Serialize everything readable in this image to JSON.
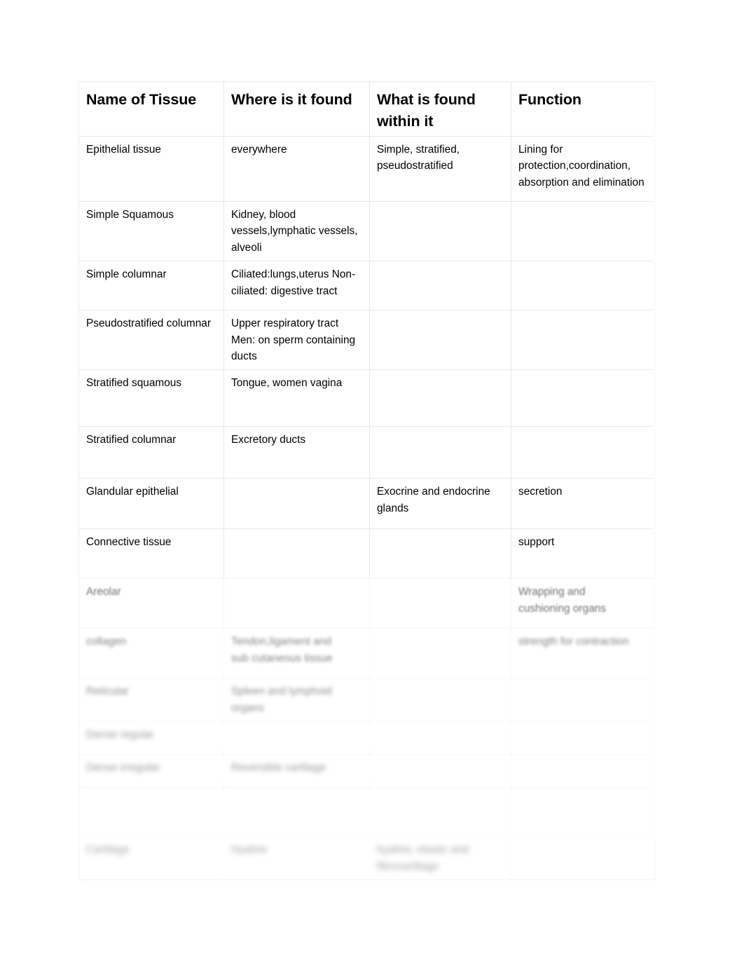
{
  "document": {
    "title": "Name of Tissue",
    "type": "study-table",
    "columns": [
      "Name of Tissue",
      "Where is it found",
      "What is found within it",
      "Function"
    ],
    "note_legibility": "Lower portion of the scanned page is progressively out of focus; text in those rows is not legible."
  },
  "rows": [
    {
      "name": "Epithelial tissue",
      "where": "everywhere",
      "within": "Simple, stratified, pseudostratified",
      "function": "Lining for protection,coordination, absorption and elimination",
      "legible": true,
      "blur": 0
    },
    {
      "name": "Simple Squamous",
      "where": "Kidney, blood vessels,lymphatic vessels, alveoli",
      "within": "",
      "function": "",
      "legible": true,
      "blur": 0
    },
    {
      "name": "Simple columnar",
      "where": "Ciliated:lungs,uterus Non-ciliated: digestive tract",
      "within": "",
      "function": "",
      "legible": true,
      "blur": 0
    },
    {
      "name": "Pseudostratified columnar",
      "where": "Upper respiratory tract Men: on sperm containing ducts",
      "within": "",
      "function": "",
      "legible": true,
      "blur": 0
    },
    {
      "name": "Stratified squamous",
      "where": "Tongue, women vagina",
      "within": "",
      "function": "",
      "legible": true,
      "blur": 0
    },
    {
      "name": "Stratified columnar",
      "where": "Excretory ducts",
      "within": "",
      "function": "",
      "legible": true,
      "blur": 0
    },
    {
      "name": "Glandular epithelial",
      "where": "",
      "within": "Exocrine and endocrine glands",
      "function": "secretion",
      "legible": true,
      "blur": 0
    },
    {
      "name": "Connective tissue",
      "where": "",
      "within": "",
      "function": "support",
      "legible": true,
      "blur": 1
    },
    {
      "name": "Areolar",
      "where": "",
      "within": "",
      "function": "",
      "legible": false,
      "blur": 2
    },
    {
      "name": "",
      "where": "",
      "within": "",
      "function": "",
      "legible": false,
      "blur": 3
    },
    {
      "name": "",
      "where": "",
      "within": "",
      "function": "",
      "legible": false,
      "blur": 4
    },
    {
      "name": "",
      "where": "",
      "within": "",
      "function": "",
      "legible": false,
      "blur": 5
    },
    {
      "name": "",
      "where": "",
      "within": "",
      "function": "",
      "legible": false,
      "blur": 5
    },
    {
      "name": "",
      "where": "",
      "within": "",
      "function": "",
      "legible": false,
      "blur": 6
    },
    {
      "name": "",
      "where": "",
      "within": "",
      "function": "",
      "legible": false,
      "blur": 6
    }
  ],
  "illegible_rows": {
    "r9": {
      "function_line1": "Wrapping and",
      "function_line2": "cushioning organs"
    },
    "r10": {
      "name": "collagen",
      "where_line1": "Tendon,ligament and",
      "where_line2": "sub cutaneous tissue",
      "function": "strength for contraction"
    },
    "r11": {
      "name": "Reticular",
      "where_line1": "Spleen and lymphoid",
      "where_line2": "organs"
    },
    "r12": {
      "name": "Dense regular"
    },
    "r13": {
      "name": "Dense irregular",
      "where": "Reversible cartilage"
    },
    "r15": {
      "name": "Cartilage",
      "where": "Hyaline",
      "within_line1": "hyaline, elastic and",
      "within_line2": "fibrocartilage"
    }
  },
  "colors": {
    "page_background": "#ffffff",
    "table_background": "#ffffff",
    "grid_line": "#e8e8e8",
    "text": "#000000",
    "blurred_text": "#8e8e8e"
  }
}
